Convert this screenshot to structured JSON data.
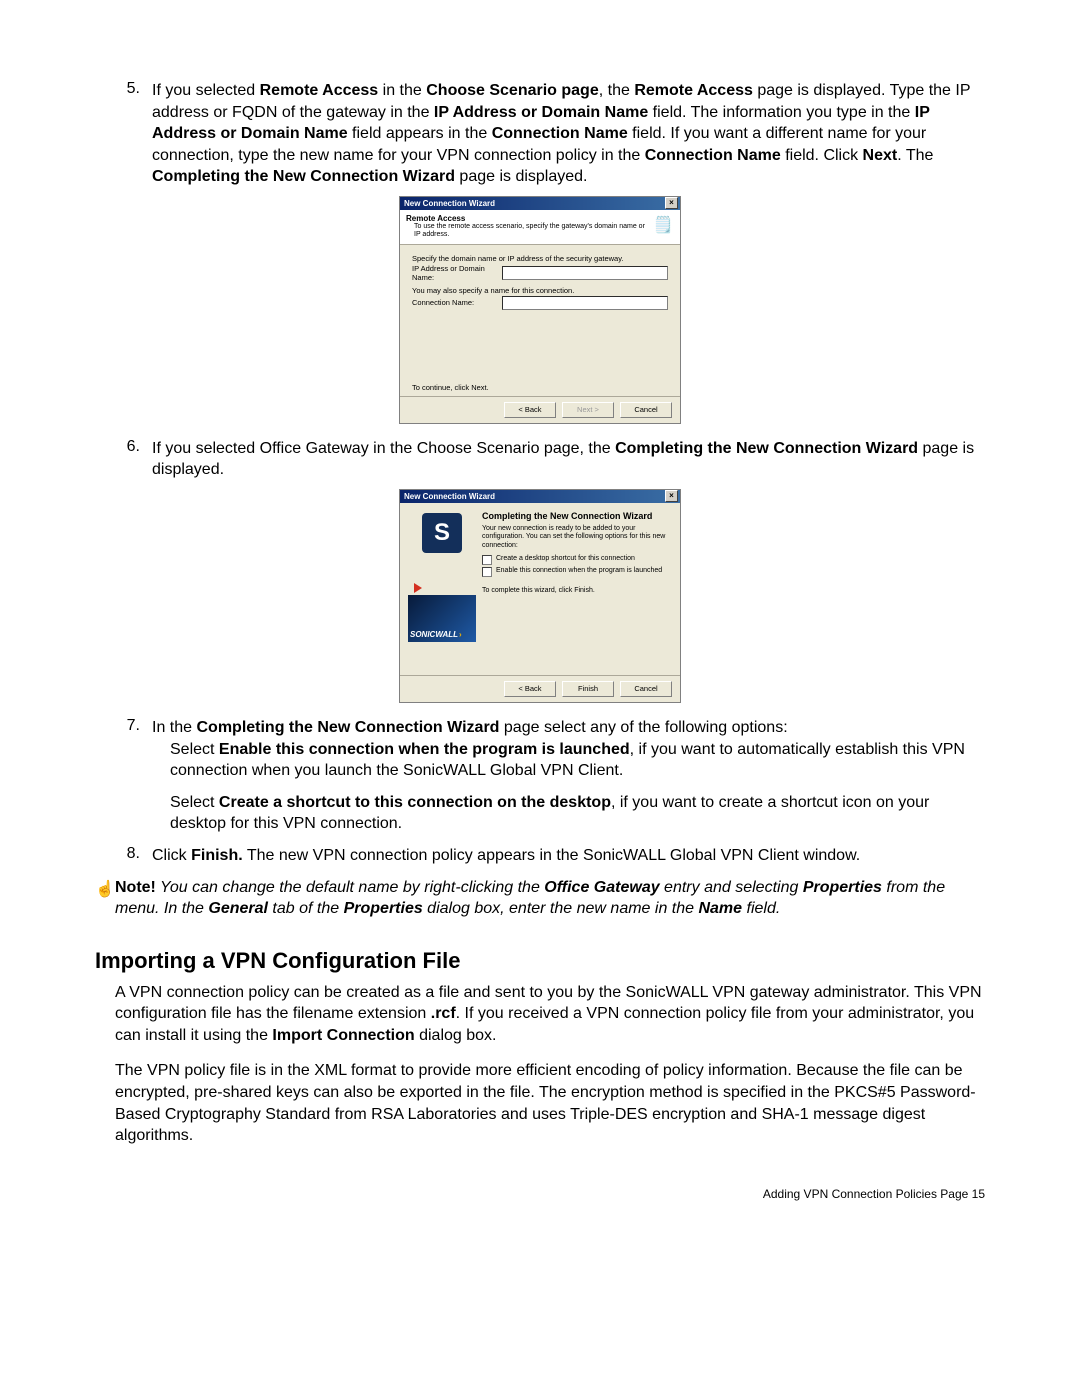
{
  "step5": {
    "num": "5.",
    "t1": "If you selected ",
    "b1": "Remote Access",
    "t2": " in the ",
    "b2": "Choose Scenario page",
    "t3": ", the ",
    "b3": "Remote Access",
    "t4": " page is displayed. Type the IP address or FQDN of the gateway in the ",
    "b4": "IP Address or Domain Name",
    "t5": " field. The information you type in the ",
    "b5": "IP Address or Domain Name",
    "t6": " field appears in the ",
    "b6": "Connection Name",
    "t7": " field. If you want a different name for your connection, type the new name for your VPN connection policy in the ",
    "b7": "Connection Name",
    "t8": " field. Click ",
    "b8": "Next",
    "t9": ". The ",
    "b9": "Completing the New Connection Wizard",
    "t10": " page is displayed."
  },
  "dlg1": {
    "title": "New Connection Wizard",
    "close": "×",
    "header_title": "Remote Access",
    "header_sub": "To use the remote access scenario, specify the gateway's domain name or IP address.",
    "prompt": "Specify the domain name or IP address of the security gateway.",
    "ip_label": "IP Address or Domain Name:",
    "name_hint": "You may also specify a name for this connection.",
    "conn_label": "Connection Name:",
    "continue": "To continue, click Next.",
    "back": "< Back",
    "next": "Next >",
    "cancel": "Cancel"
  },
  "step6": {
    "num": "6.",
    "t1": "If you selected Office Gateway in the Choose Scenario page, the ",
    "b1": "Completing the New Connection Wizard",
    "t2": " page is displayed."
  },
  "dlg2": {
    "title": "New Connection Wizard",
    "close": "×",
    "heading": "Completing the New Connection Wizard",
    "intro": "Your new connection is ready to be added to your configuration. You can set the following options for this new connection:",
    "cb1": "Create a desktop shortcut for this connection",
    "cb2": "Enable this connection when the program is launched",
    "finish_hint": "To complete this wizard, click Finish.",
    "brand": "SONICWALL",
    "back": "< Back",
    "finish": "Finish",
    "cancel": "Cancel",
    "logo_letter": "S"
  },
  "step7": {
    "num": "7.",
    "t1": "In the ",
    "b1": "Completing the New Connection Wizard",
    "t2": " page select any of the following options:"
  },
  "step7a": {
    "t1": "Select ",
    "b1": "Enable this connection when the program is launched",
    "t2": ", if you want to automatically establish this VPN connection when you launch the SonicWALL Global VPN Client."
  },
  "step7b": {
    "t1": "Select ",
    "b1": "Create a shortcut to this connection on the desktop",
    "t2": ", if you want to create a shortcut icon on your desktop for this VPN connection."
  },
  "step8": {
    "num": "8.",
    "t1": "Click ",
    "b1": "Finish.",
    "t2": " The new VPN connection policy appears in the SonicWALL Global VPN Client window."
  },
  "note": {
    "label": "Note!",
    "t1": " You can change the default name by right-clicking the ",
    "b1": "Office Gateway",
    "t2": " entry and selecting ",
    "b2": "Properties",
    "t3": " from the menu. In the ",
    "b3": "General",
    "t4": " tab of the ",
    "b4": "Properties",
    "t5": " dialog box, enter the new name in the ",
    "b5": "Name",
    "t6": " field."
  },
  "section_heading": "Importing a VPN Configuration File",
  "para1": {
    "t1": "A VPN connection policy can be created as a file and sent to you by the SonicWALL VPN gateway administrator. This VPN configuration file has the filename extension ",
    "b1": ".rcf",
    "t2": ". If you received a VPN connection policy file from your administrator, you can install it using the ",
    "b2": "Import Connection",
    "t3": " dialog box."
  },
  "para2": "The VPN policy file is in the XML format to provide more efficient encoding of policy information. Because the file can be encrypted, pre-shared keys can also be exported in the file. The encryption method is specified in the PKCS#5 Password-Based Cryptography Standard from RSA Laboratories and uses Triple-DES encryption and SHA-1 message digest algorithms.",
  "footer": "Adding VPN Connection Policies Page 15"
}
